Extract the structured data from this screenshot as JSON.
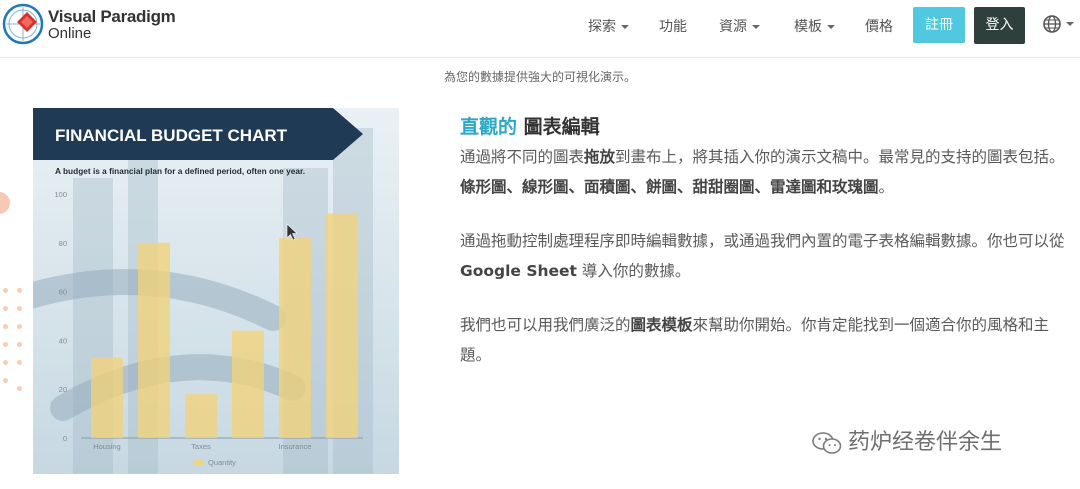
{
  "brand": {
    "line1": "Visual Paradigm",
    "line2": "Online"
  },
  "nav": {
    "items": [
      {
        "label": "探索",
        "has_dropdown": true
      },
      {
        "label": "功能",
        "has_dropdown": false
      },
      {
        "label": "資源",
        "has_dropdown": true
      },
      {
        "label": "模板",
        "has_dropdown": true
      },
      {
        "label": "價格",
        "has_dropdown": false
      }
    ],
    "register": "註冊",
    "login": "登入",
    "language_icon": "globe-icon"
  },
  "subtitle": "為您的數據提供強大的可視化演示。",
  "chart_image": {
    "chart_data": {
      "type": "bar",
      "title": "FINANCIAL BUDGET CHART",
      "subtitle": "A budget is a financial plan for a defined period, often one year.",
      "categories": [
        "Housing",
        "",
        "Taxes",
        "",
        "Insurance",
        ""
      ],
      "values": [
        33,
        80,
        18,
        44,
        82,
        92
      ],
      "yticks": [
        "100",
        "80",
        "60",
        "40",
        "20",
        "0"
      ],
      "ylim": [
        0,
        100
      ],
      "legend": "Quantity",
      "bar_color": "#f2d27a",
      "header_color": "#1f3a55"
    }
  },
  "feature": {
    "headline_accent": "直觀的",
    "headline_rest": "圖表編輯",
    "p1_a": "通過將不同的圖表",
    "p1_b": "拖放",
    "p1_c": "到畫布上，將其插入你的演示文稿中。最常見的支持的圖表包括。",
    "p1_d": "條形圖、線形圖、面積圖、餅圖、甜甜圈圖、雷達圖和玫瑰圖",
    "p1_e": "。",
    "p2_a": "通過拖動控制處理程序即時編輯數據，或通過我們內置的電子表格編輯數據。你也可以從",
    "p2_b": "Google Sheet",
    "p2_c": "導入你的數據。",
    "p3_a": "我們也可以用我們廣泛的",
    "p3_b": "圖表模板",
    "p3_c": "來幫助你開始。你肯定能找到一個適合你的風格和主題。"
  },
  "watermark": "药炉经卷伴余生",
  "colors": {
    "accent": "#2aa8c7",
    "register_bg": "#4fc8e0",
    "login_bg": "#2f3f3b"
  }
}
